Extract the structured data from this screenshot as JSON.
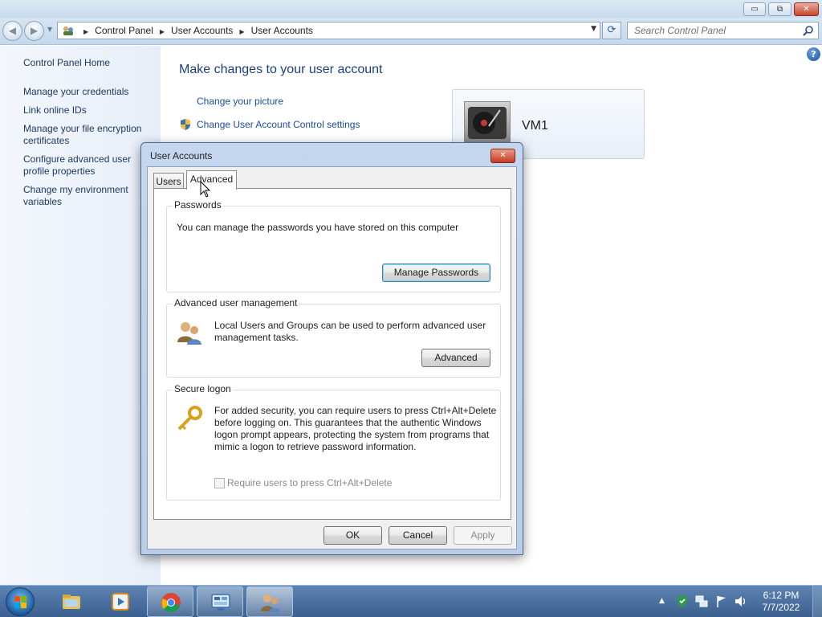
{
  "window": {
    "controls": {
      "minimize": "▭",
      "maximize": "⧉",
      "close": "✕"
    }
  },
  "nav": {
    "back_icon": "back-arrow-icon",
    "forward_icon": "forward-arrow-icon",
    "breadcrumb": [
      "Control Panel",
      "User Accounts",
      "User Accounts"
    ],
    "search_placeholder": "Search Control Panel"
  },
  "sidebar": {
    "items": [
      {
        "label": "Control Panel Home"
      },
      {
        "label": "Manage your credentials"
      },
      {
        "label": "Link online IDs"
      },
      {
        "label": "Manage your file encryption certificates"
      },
      {
        "label": "Configure advanced user profile properties"
      },
      {
        "label": "Change my environment variables"
      }
    ]
  },
  "main": {
    "heading": "Make changes to your user account",
    "tasks": [
      {
        "label": "Change your picture"
      },
      {
        "label": "Change User Account Control settings"
      }
    ],
    "user": {
      "name": "VM1"
    }
  },
  "dialog": {
    "title": "User Accounts",
    "close_glyph": "✕",
    "tabs": [
      {
        "label": "Users"
      },
      {
        "label": "Advanced"
      }
    ],
    "active_tab": "Advanced",
    "passwords": {
      "title": "Passwords",
      "text": "You can manage the passwords you have stored on this computer",
      "button": "Manage Passwords"
    },
    "advanced_user_management": {
      "title": "Advanced user management",
      "text": "Local Users and Groups can be used to perform advanced user management tasks.",
      "button": "Advanced"
    },
    "secure_logon": {
      "title": "Secure logon",
      "text": "For added security, you can require users to press Ctrl+Alt+Delete before logging on. This guarantees that the authentic Windows logon prompt appears, protecting the system from programs that mimic a logon to retrieve password information.",
      "checkbox_label": "Require users to press Ctrl+Alt+Delete",
      "checkbox_checked": false,
      "checkbox_enabled": false
    },
    "buttons": {
      "ok": "OK",
      "cancel": "Cancel",
      "apply": "Apply"
    }
  },
  "taskbar": {
    "apps": [
      "windows-explorer-icon",
      "media-player-icon",
      "chrome-icon",
      "control-panel-icon",
      "user-accounts-icon"
    ],
    "tray": {
      "show_hidden": "▲"
    },
    "clock": {
      "time": "6:12 PM",
      "date": "7/7/2022"
    }
  },
  "colors": {
    "link": "#1a4ea1",
    "heading": "#1e3e80",
    "taskbar": "#4a6f9e"
  }
}
